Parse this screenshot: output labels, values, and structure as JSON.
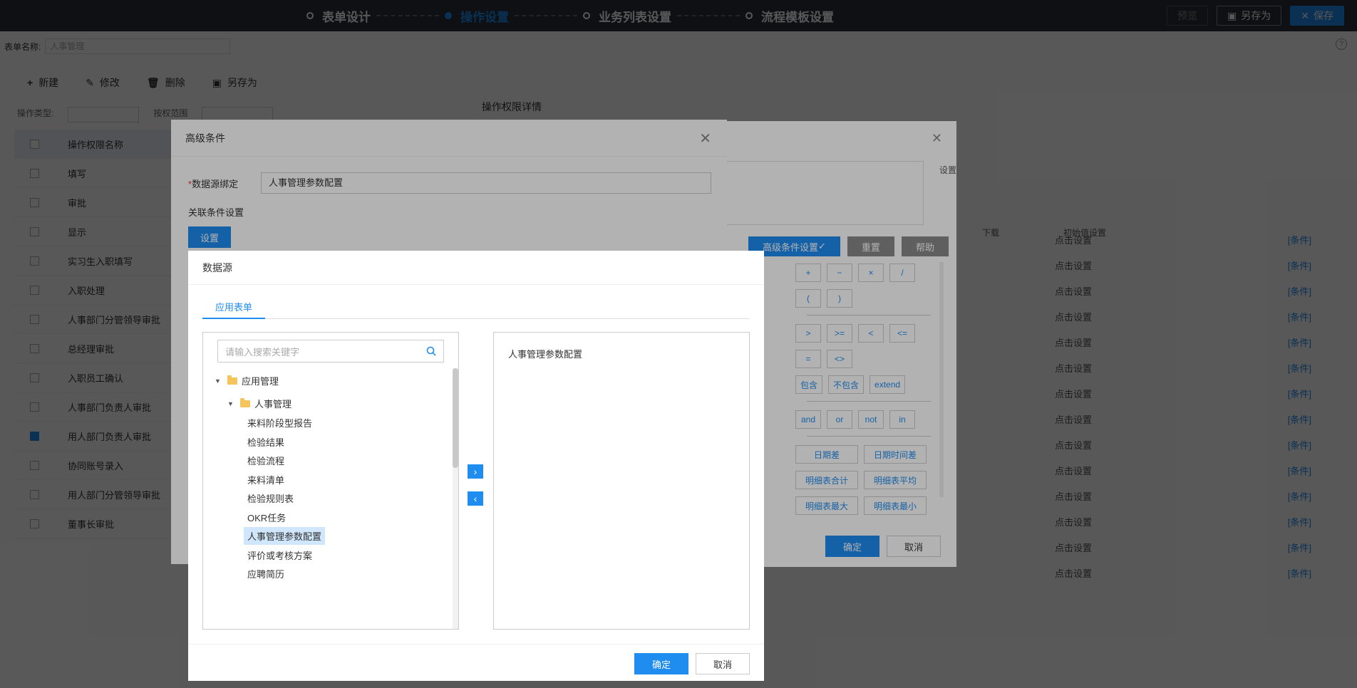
{
  "topbar": {
    "steps": [
      {
        "label": "表单设计"
      },
      {
        "label": "操作设置"
      },
      {
        "label": "业务列表设置"
      },
      {
        "label": "流程模板设置"
      }
    ],
    "preview_label": "预览",
    "saveas_label": "另存为",
    "save_label": "保存"
  },
  "form": {
    "name_label": "表单名称:",
    "name_value": "人事管理"
  },
  "toolbar": {
    "new": "新建",
    "edit": "修改",
    "delete": "删除",
    "saveas": "另存为"
  },
  "filters": {
    "type_label": "操作类型:",
    "scope_label": "按权范围"
  },
  "perm_list": {
    "header": "操作权限名称",
    "rows": [
      {
        "label": "填写",
        "checked": false
      },
      {
        "label": "审批",
        "checked": false
      },
      {
        "label": "显示",
        "checked": false
      },
      {
        "label": "实习生入职填写",
        "checked": false
      },
      {
        "label": "入职处理",
        "checked": false
      },
      {
        "label": "人事部门分管领导审批",
        "checked": false
      },
      {
        "label": "总经理审批",
        "checked": false
      },
      {
        "label": "入职员工确认",
        "checked": false
      },
      {
        "label": "人事部门负责人审批",
        "checked": false
      },
      {
        "label": "用人部门负责人审批",
        "checked": true
      },
      {
        "label": "协同账号录入",
        "checked": false
      },
      {
        "label": "用人部门分管领导审批",
        "checked": false
      },
      {
        "label": "董事长审批",
        "checked": false
      }
    ]
  },
  "perm_detail_title": "操作权限详情",
  "right_header": {
    "col1": "下载",
    "col2": "初始值设置"
  },
  "right_rows": [
    "点击设置",
    "点击设置",
    "点击设置",
    "点击设置",
    "点击设置",
    "点击设置",
    "点击设置",
    "点击设置",
    "点击设置",
    "点击设置",
    "点击设置",
    "点击设置",
    "点击设置",
    "点击设置"
  ],
  "right_link": "[条件]",
  "formula_dialog": {
    "side_label": "设置",
    "adv_btn": "高级条件设置",
    "reset_btn": "重置",
    "help_btn": "帮助",
    "ops_row1": [
      "+",
      "−",
      "×",
      "/"
    ],
    "ops_row2": [
      "(",
      ")"
    ],
    "ops_row3": [
      ">",
      ">=",
      "<",
      "<="
    ],
    "ops_row4": [
      "=",
      "<>"
    ],
    "ops_row5": [
      "包含",
      "不包含",
      "extend"
    ],
    "ops_row6": [
      "and",
      "or",
      "not",
      "in"
    ],
    "func_row1": [
      "日期差",
      "日期时间差"
    ],
    "func_row2": [
      "明细表合计",
      "明细表平均"
    ],
    "func_row3": [
      "明细表最大",
      "明细表最小"
    ],
    "ok": "确定",
    "cancel": "取消"
  },
  "adv_dialog": {
    "title": "高级条件",
    "required_mark": "*",
    "ds_label": "数据源绑定",
    "ds_value": "人事管理参数配置",
    "cond_label": "关联条件设置",
    "set_btn": "设置"
  },
  "ds_dialog": {
    "title": "数据源",
    "tab": "应用表单",
    "search_placeholder": "请输入搜索关键字",
    "tree": {
      "root": "应用管理",
      "group": "人事管理",
      "leaves": [
        "来料阶段型报告",
        "检验结果",
        "检验流程",
        "来料清单",
        "检验规则表",
        "OKR任务",
        "人事管理参数配置",
        "评价或考核方案",
        "应聘简历"
      ]
    },
    "selected_item": "人事管理参数配置",
    "move_right": "›",
    "move_left": "‹",
    "ok": "确定",
    "cancel": "取消"
  },
  "colors": {
    "accent": "#1f8cf0",
    "topbar": "#2b2f3a",
    "folder": "#f5c55a"
  }
}
